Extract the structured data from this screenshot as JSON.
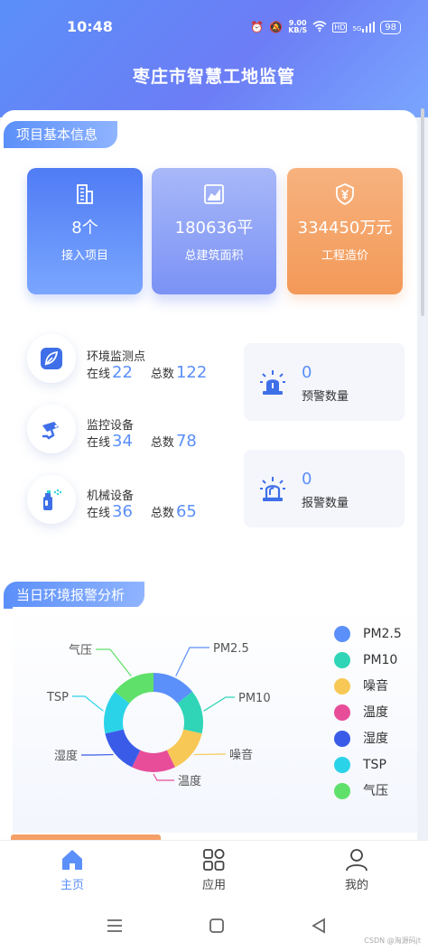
{
  "status_bar": {
    "time": "10:48",
    "speed_value": "9.00",
    "speed_unit": "KB/S",
    "battery": "98",
    "hd": "HD",
    "net": "5G"
  },
  "app": {
    "title": "枣庄市智慧工地监管"
  },
  "project_info": {
    "section_title": "项目基本信息",
    "cards": [
      {
        "value": "8个",
        "label": "接入项目",
        "icon": "building-icon"
      },
      {
        "value": "180636平",
        "label": "总建筑面积",
        "icon": "area-chart-icon"
      },
      {
        "value": "334450万元",
        "label": "工程造价",
        "icon": "money-shield-icon"
      }
    ]
  },
  "devices": [
    {
      "name": "环境监测点",
      "online_label": "在线",
      "online": "22",
      "total_label": "总数",
      "total": "122",
      "icon": "leaf-icon"
    },
    {
      "name": "监控设备",
      "online_label": "在线",
      "online": "34",
      "total_label": "总数",
      "total": "78",
      "icon": "camera-icon"
    },
    {
      "name": "机械设备",
      "online_label": "在线",
      "online": "36",
      "total_label": "总数",
      "total": "65",
      "icon": "spray-icon"
    }
  ],
  "alerts": [
    {
      "value": "0",
      "label": "预警数量",
      "icon": "warning-light-icon"
    },
    {
      "value": "0",
      "label": "报警数量",
      "icon": "alarm-light-icon"
    }
  ],
  "env_alarm": {
    "section_title": "当日环境报警分析",
    "chart_data": {
      "type": "pie",
      "categories": [
        "PM2.5",
        "PM10",
        "噪音",
        "温度",
        "湿度",
        "TSP",
        "气压"
      ],
      "values": [
        1,
        1,
        1,
        1,
        1,
        1,
        1
      ],
      "colors": [
        "#5b8ff9",
        "#2fd5b6",
        "#f7c855",
        "#e84d9a",
        "#3a5be8",
        "#2bd3e8",
        "#5fe06a"
      ],
      "chart_labels": [
        "PM2.5",
        "PM10",
        "噪音",
        "温度",
        "湿度",
        "TSP",
        "气压"
      ],
      "legend_position": "right"
    }
  },
  "nav": [
    {
      "label": "主页",
      "icon": "home-icon",
      "active": true
    },
    {
      "label": "应用",
      "icon": "apps-icon",
      "active": false
    },
    {
      "label": "我的",
      "icon": "user-icon",
      "active": false
    }
  ],
  "watermark": "CSDN @淘源码jt"
}
